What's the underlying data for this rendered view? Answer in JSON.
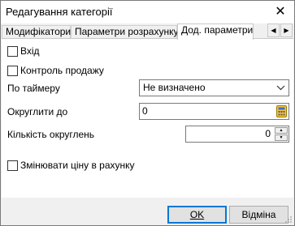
{
  "window": {
    "title": "Редагування категорії"
  },
  "tabs": [
    {
      "label": "Модифікатори"
    },
    {
      "label": "Параметри розрахунку"
    },
    {
      "label": "Дод. параметри"
    }
  ],
  "active_tab": 2,
  "form": {
    "entry": {
      "label": "Вхід",
      "checked": false
    },
    "sales_control": {
      "label": "Контроль продажу",
      "checked": false
    },
    "timer": {
      "label": "По таймеру",
      "value": "Не визначено"
    },
    "round_to": {
      "label": "Округлити до",
      "value": "0"
    },
    "round_count": {
      "label": "Кількість округлень",
      "value": "0"
    },
    "change_price": {
      "label": "Змінювати ціну в рахунку",
      "checked": false
    }
  },
  "buttons": {
    "ok": "OK",
    "cancel": "Відміна"
  }
}
